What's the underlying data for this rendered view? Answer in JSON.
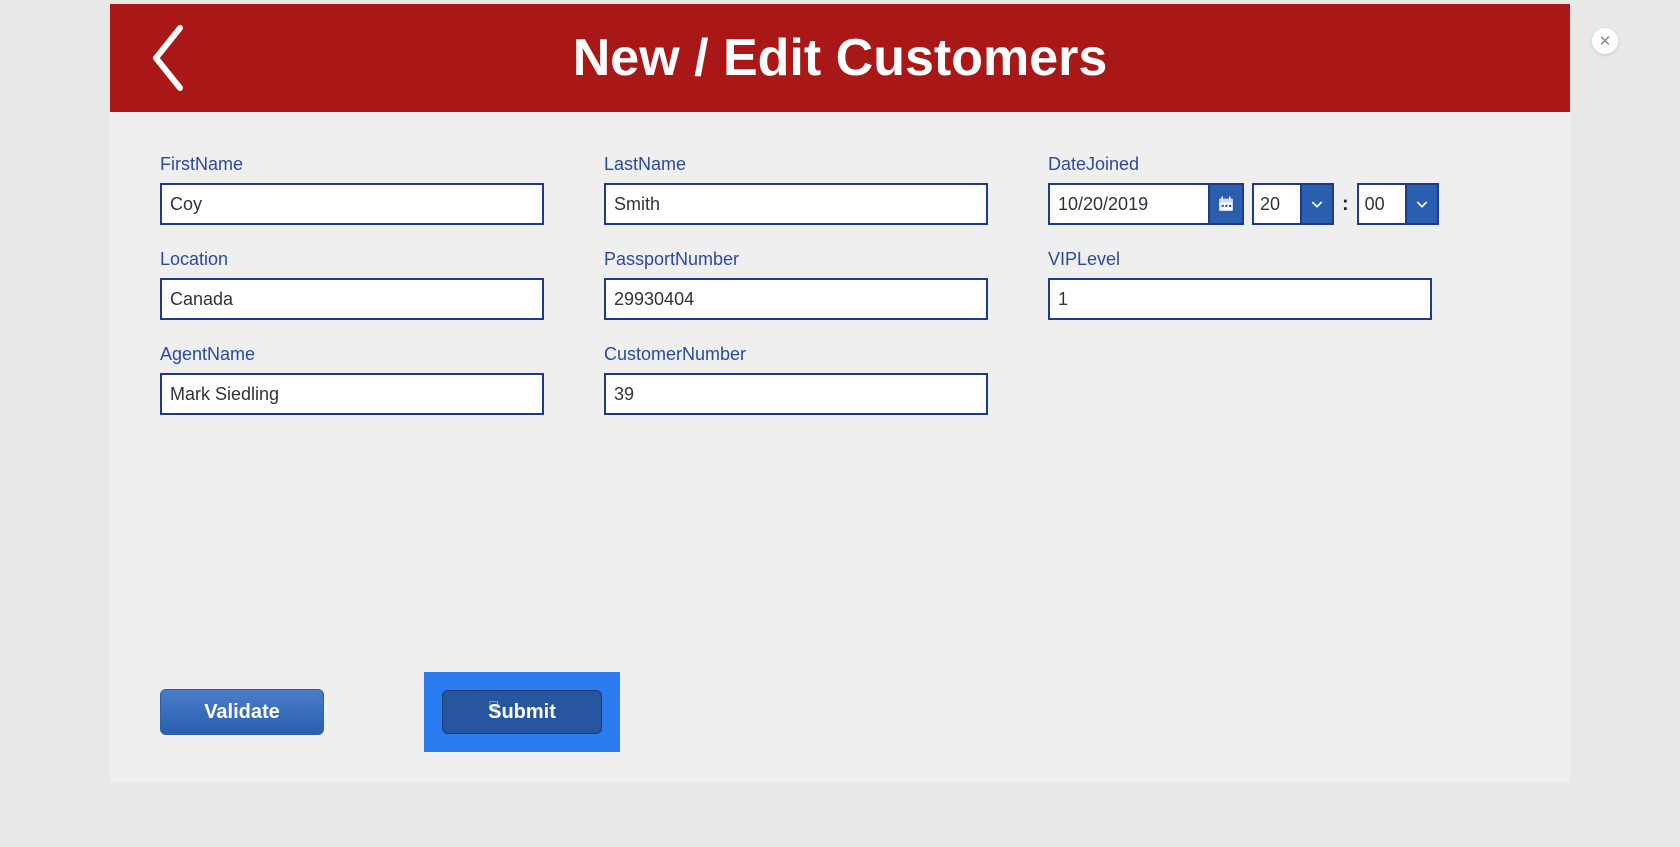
{
  "header": {
    "title": "New / Edit Customers"
  },
  "form": {
    "firstName": {
      "label": "FirstName",
      "value": "Coy"
    },
    "lastName": {
      "label": "LastName",
      "value": "Smith"
    },
    "dateJoined": {
      "label": "DateJoined",
      "date": "10/20/2019",
      "hour": "20",
      "minute": "00",
      "separator": ":"
    },
    "location": {
      "label": "Location",
      "value": "Canada"
    },
    "passportNumber": {
      "label": "PassportNumber",
      "value": "29930404"
    },
    "vipLevel": {
      "label": "VIPLevel",
      "value": "1"
    },
    "agentName": {
      "label": "AgentName",
      "value": "Mark Siedling"
    },
    "customerNumber": {
      "label": "CustomerNumber",
      "value": "39"
    }
  },
  "actions": {
    "validate": "Validate",
    "submit": "Submit"
  }
}
